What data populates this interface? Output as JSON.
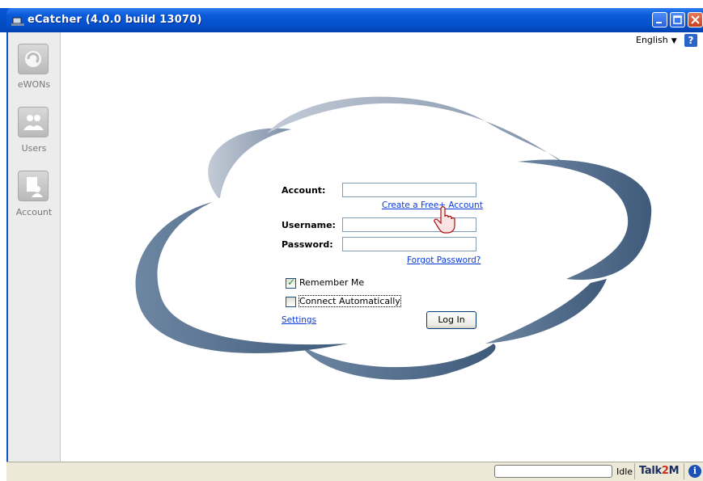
{
  "window": {
    "title": "eCatcher (4.0.0 build 13070)"
  },
  "sidebar": {
    "items": [
      {
        "label": "eWONs",
        "icon": "ewon-icon"
      },
      {
        "label": "Users",
        "icon": "users-icon"
      },
      {
        "label": "Account",
        "icon": "account-icon"
      }
    ]
  },
  "header": {
    "language": "English",
    "help_label": "?"
  },
  "login": {
    "account_label": "Account:",
    "account_value": "",
    "create_account_link": "Create a Free+ Account",
    "username_label": "Username:",
    "username_value": "",
    "password_label": "Password:",
    "password_value": "",
    "forgot_password_link": "Forgot Password?",
    "remember_me_label": "Remember Me",
    "remember_me_checked": true,
    "connect_auto_label": "Connect Automatically",
    "connect_auto_checked": false,
    "settings_link": "Settings",
    "login_button": "Log In"
  },
  "statusbar": {
    "status": "Idle",
    "brand_part1": "Talk",
    "brand_part2": "2",
    "brand_part3": "M",
    "info_label": "i"
  },
  "colors": {
    "titlebar": "#0553d0",
    "link": "#0b3bd6",
    "cloud_dark": "#4d6784",
    "cloud_light": "#aab6c8"
  }
}
